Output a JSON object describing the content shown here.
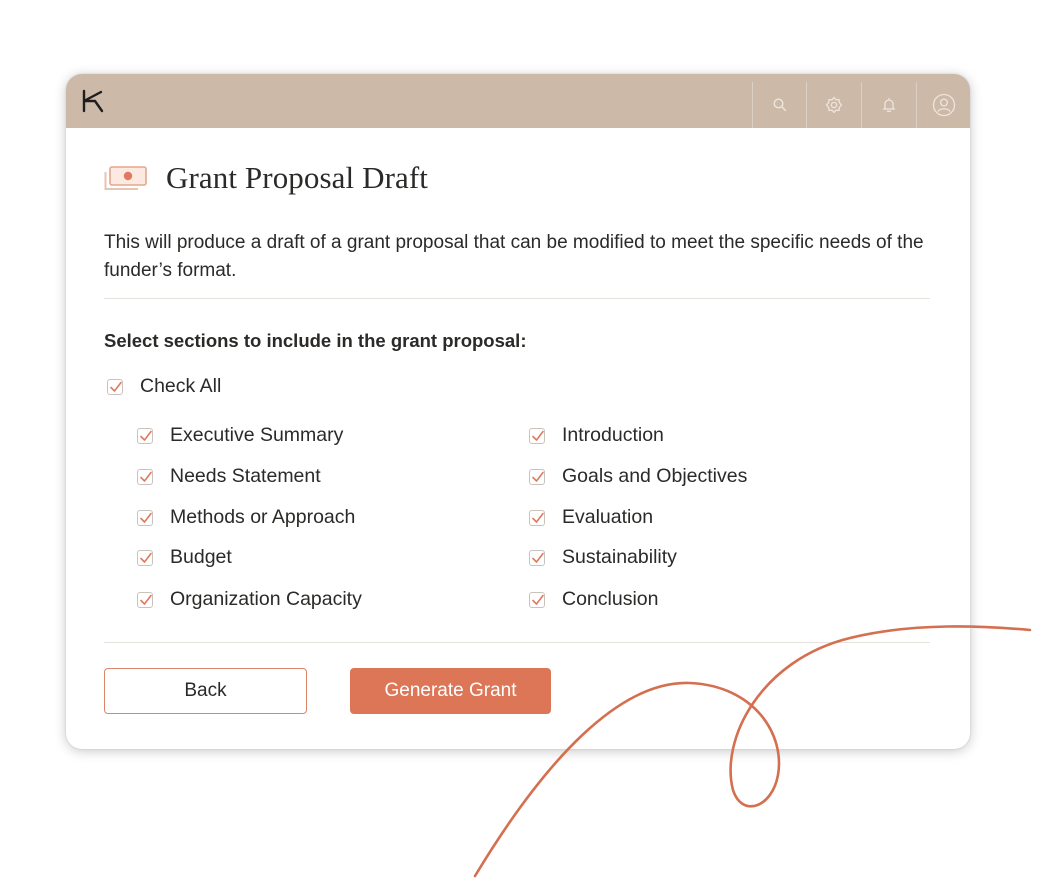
{
  "app": {
    "logo": "K",
    "toolbar_icons": [
      "search-icon",
      "settings-icon",
      "bell-icon",
      "user-icon"
    ]
  },
  "page": {
    "title": "Grant Proposal Draft",
    "title_icon": "money-icon",
    "description": "This will produce a draft of a grant proposal that can be modified to meet the specific needs of the funder’s format."
  },
  "sections": {
    "heading": "Select sections to include in the grant proposal:",
    "check_all": {
      "label": "Check All",
      "checked": true
    },
    "left": [
      {
        "label": "Executive Summary",
        "checked": true
      },
      {
        "label": "Needs Statement",
        "checked": true
      },
      {
        "label": "Methods or Approach",
        "checked": true
      },
      {
        "label": "Budget",
        "checked": true
      },
      {
        "label": "Organization Capacity",
        "checked": true
      }
    ],
    "right": [
      {
        "label": "Introduction",
        "checked": true
      },
      {
        "label": "Goals and Objectives",
        "checked": true
      },
      {
        "label": "Evaluation",
        "checked": true
      },
      {
        "label": "Sustainability",
        "checked": true
      },
      {
        "label": "Conclusion",
        "checked": true
      }
    ]
  },
  "actions": {
    "back_label": "Back",
    "generate_label": "Generate Grant"
  },
  "colors": {
    "topbar": "#ccb9a8",
    "accent": "#dd7656",
    "check": "#e07a5f"
  }
}
